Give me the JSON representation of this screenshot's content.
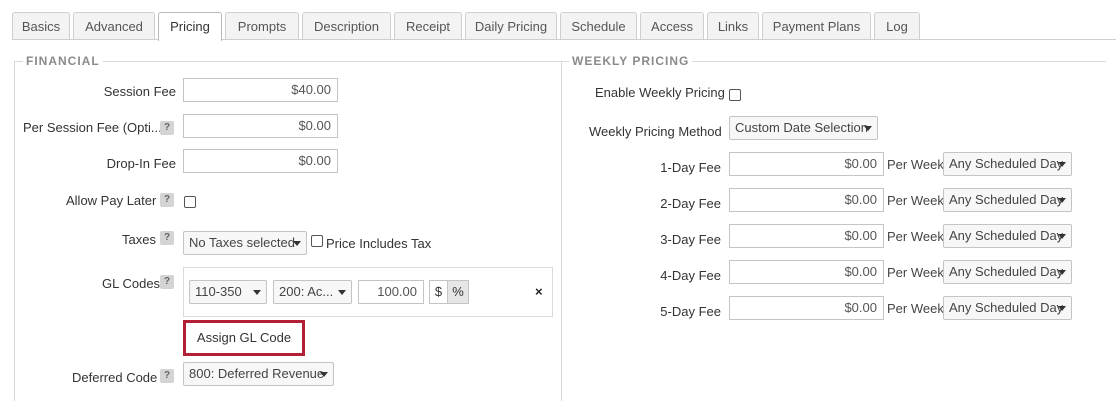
{
  "tabs": [
    {
      "label": "Basics",
      "active": false
    },
    {
      "label": "Advanced",
      "active": false
    },
    {
      "label": "Pricing",
      "active": true
    },
    {
      "label": "Prompts",
      "active": false
    },
    {
      "label": "Description",
      "active": false
    },
    {
      "label": "Receipt",
      "active": false
    },
    {
      "label": "Daily Pricing",
      "active": false
    },
    {
      "label": "Schedule",
      "active": false
    },
    {
      "label": "Access",
      "active": false
    },
    {
      "label": "Links",
      "active": false
    },
    {
      "label": "Payment Plans",
      "active": false
    },
    {
      "label": "Log",
      "active": false
    }
  ],
  "financial": {
    "legend": "FINANCIAL",
    "help_glyph": "?",
    "session_fee": {
      "label": "Session Fee",
      "value": "$40.00"
    },
    "per_session_fee": {
      "label": "Per Session Fee (Opti...",
      "value": "$0.00"
    },
    "drop_in_fee": {
      "label": "Drop-In Fee",
      "value": "$0.00"
    },
    "allow_pay_later": {
      "label": "Allow Pay Later",
      "checked": false
    },
    "taxes": {
      "label": "Taxes",
      "selected": "No Taxes selected",
      "price_includes_tax_label": "Price Includes Tax",
      "price_includes_tax_checked": false
    },
    "gl_codes": {
      "label": "GL Codes",
      "row": {
        "code": "110-350",
        "account": "200: Ac...",
        "amount": "100.00",
        "dollar": "$",
        "percent": "%",
        "remove": "×"
      },
      "assign_button": "Assign GL Code"
    },
    "deferred_code": {
      "label": "Deferred Code",
      "selected": "800: Deferred Revenue"
    }
  },
  "weekly": {
    "legend": "WEEKLY PRICING",
    "enable_label": "Enable Weekly Pricing",
    "enable_checked": false,
    "method_label": "Weekly Pricing Method",
    "method_selected": "Custom Date Selection",
    "per_week": "Per Week",
    "fees": [
      {
        "label": "1-Day Fee",
        "value": "$0.00",
        "day": "Any Scheduled Day"
      },
      {
        "label": "2-Day Fee",
        "value": "$0.00",
        "day": "Any Scheduled Day"
      },
      {
        "label": "3-Day Fee",
        "value": "$0.00",
        "day": "Any Scheduled Day"
      },
      {
        "label": "4-Day Fee",
        "value": "$0.00",
        "day": "Any Scheduled Day"
      },
      {
        "label": "5-Day Fee",
        "value": "$0.00",
        "day": "Any Scheduled Day"
      }
    ]
  },
  "colors": {
    "accent_border": "#b21f37",
    "tab_active_bg": "#ffffff",
    "tab_bg": "#f3f3f3"
  }
}
